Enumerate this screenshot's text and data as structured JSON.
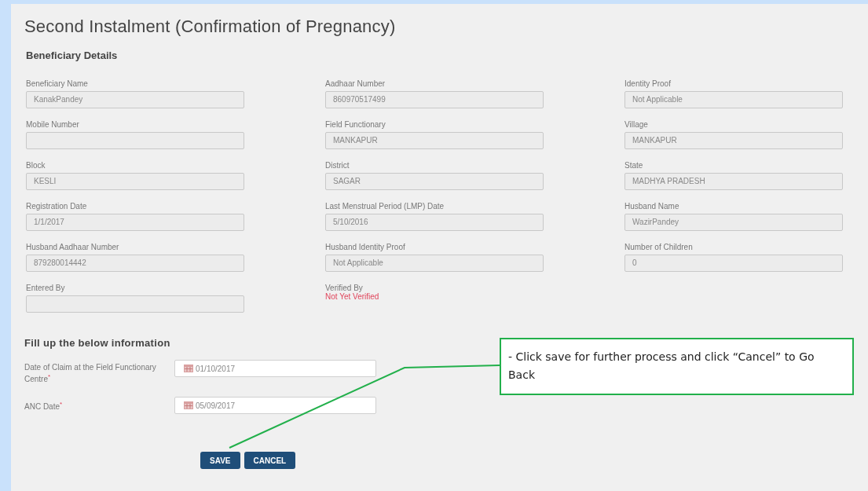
{
  "title": "Second Instalment (Confirmation of Pregnancy)",
  "beneficiary_details": {
    "heading": "Beneficiary Details",
    "fields": [
      {
        "kind": "field",
        "label": "Beneficiary Name",
        "value": "KanakPandey"
      },
      {
        "kind": "field",
        "label": "Aadhaar Number",
        "value": "860970517499"
      },
      {
        "kind": "field",
        "label": "Identity Proof",
        "value": "Not Applicable"
      },
      {
        "kind": "field",
        "label": "Mobile Number"
      },
      {
        "kind": "field",
        "label": "Field Functionary",
        "value": "MANKAPUR"
      },
      {
        "kind": "field",
        "label": "Village",
        "value": "MANKAPUR"
      },
      {
        "kind": "field",
        "label": "Block",
        "value": "KESLI"
      },
      {
        "kind": "field",
        "label": "District",
        "value": "SAGAR"
      },
      {
        "kind": "field",
        "label": "State",
        "value": "MADHYA PRADESH"
      },
      {
        "kind": "field",
        "label": "Registration Date",
        "value": "1/1/2017"
      },
      {
        "kind": "field",
        "label": "Last Menstrual Period (LMP) Date",
        "value": "5/10/2016"
      },
      {
        "kind": "field",
        "label": "Husband Name",
        "value": "WazirPandey"
      },
      {
        "kind": "field",
        "label": "Husband Aadhaar Number",
        "value": "879280014442"
      },
      {
        "kind": "field",
        "label": "Husband Identity Proof",
        "value": "Not Applicable"
      },
      {
        "kind": "field",
        "label": "Number of Children",
        "value": "0"
      },
      {
        "kind": "field",
        "label": "Entered By"
      },
      {
        "kind": "status",
        "label": "Verified By",
        "value": "Not Yet Verified"
      }
    ]
  },
  "fill_up": {
    "heading": "Fill up the below information",
    "fields": [
      {
        "label": "Date of Claim at the Field Functionary Centre",
        "required_mark": "*",
        "value": "01/10/2017"
      },
      {
        "label": "ANC Date",
        "required_mark": "*",
        "value": "05/09/2017"
      }
    ]
  },
  "buttons": [
    "SAVE",
    "CANCEL"
  ],
  "callout": {
    "text": "-  Click save for further process and click “Cancel” to Go Back"
  }
}
